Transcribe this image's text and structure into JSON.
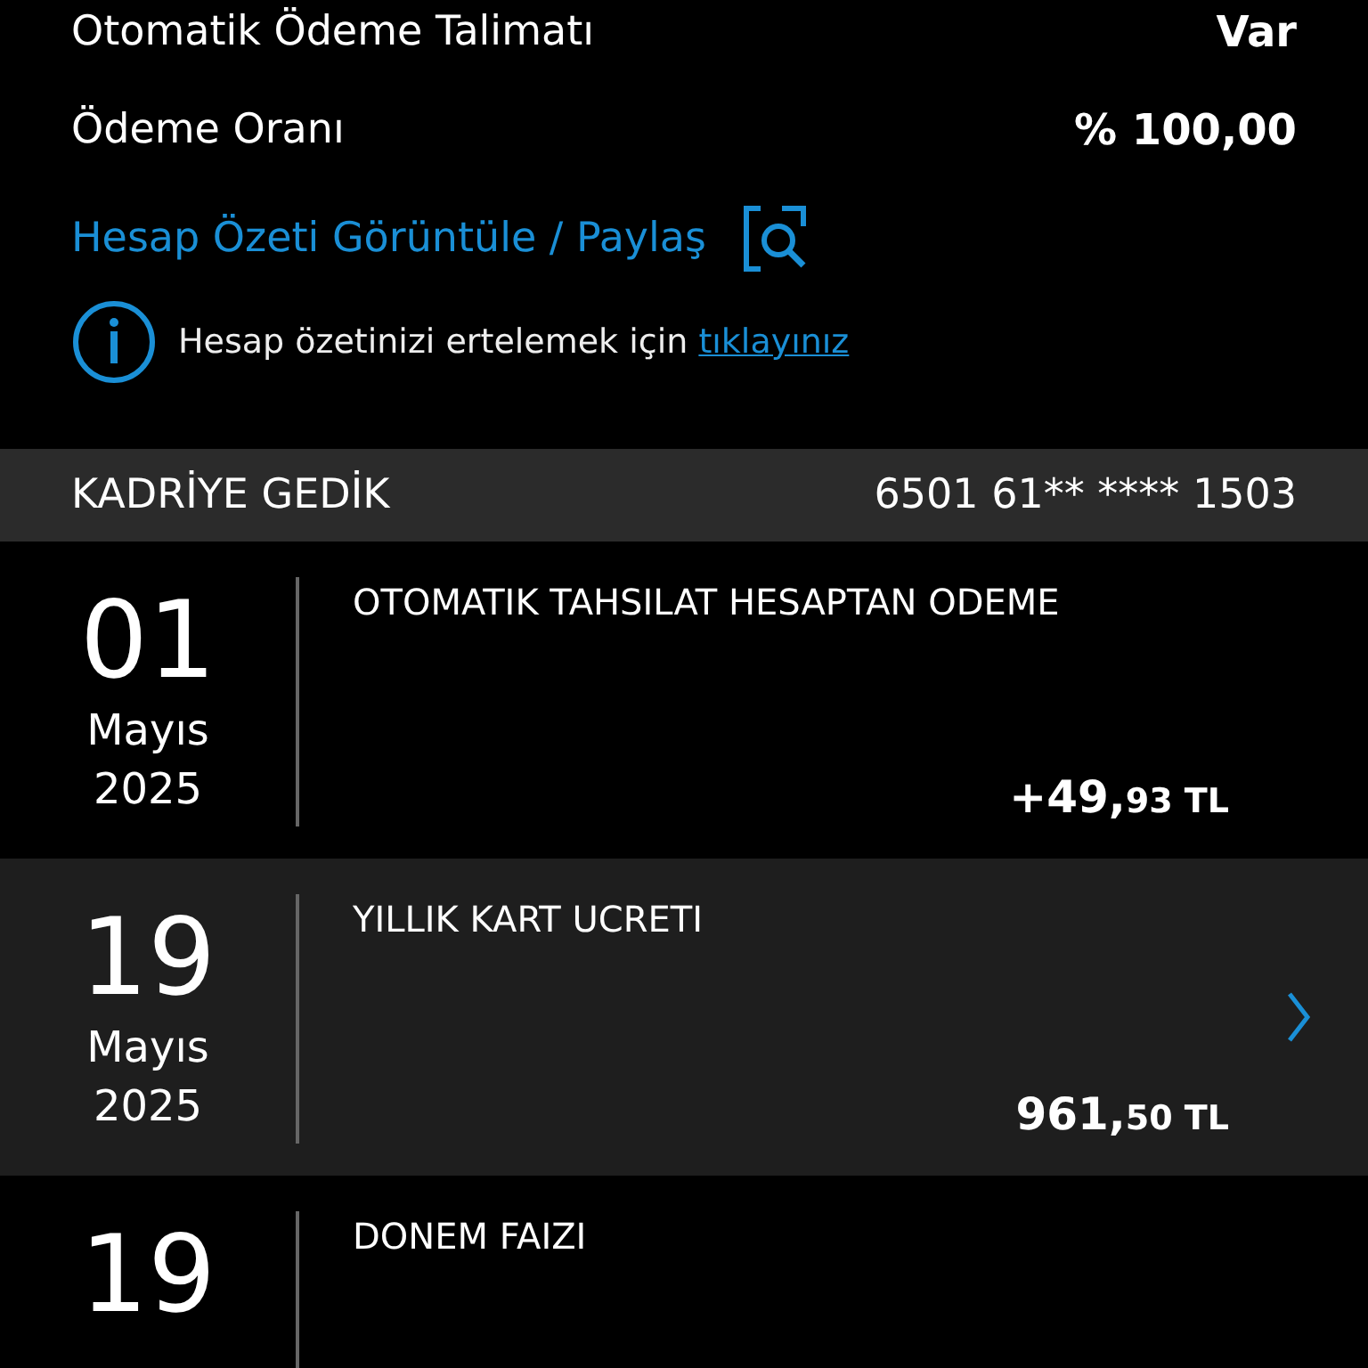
{
  "summary": [
    {
      "label": "Otomatik Ödeme Talimatı",
      "value": "Var"
    },
    {
      "label": "Ödeme Oranı",
      "value": "% 100,00"
    }
  ],
  "statement_link": {
    "label": "Hesap Özeti Görüntüle / Paylaş"
  },
  "notice": {
    "text": "Hesap özetinizi ertelemek için",
    "link": "tıklayınız"
  },
  "card_header": {
    "holder": "KADRİYE GEDİK",
    "number": "6501 61** **** 1503"
  },
  "transactions": [
    {
      "day": "01",
      "month": "Mayıs",
      "year": "2025",
      "description": "OTOMATIK TAHSILAT HESAPTAN ODEME",
      "amount_main": "+49,",
      "amount_fraction": "93 TL",
      "selected": false
    },
    {
      "day": "19",
      "month": "Mayıs",
      "year": "2025",
      "description": "YILLIK KART UCRETI",
      "amount_main": "961,",
      "amount_fraction": "50 TL",
      "selected": true
    },
    {
      "day": "19",
      "description": "DONEM FAIZI",
      "selected": false
    }
  ]
}
